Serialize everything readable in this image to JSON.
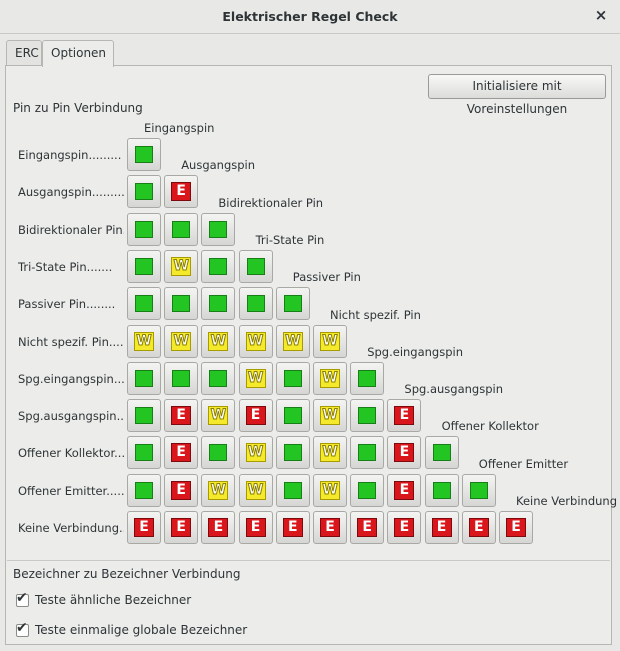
{
  "window": {
    "title": "Elektrischer Regel Check",
    "close_icon": "×"
  },
  "tabs": [
    {
      "label": "ERC",
      "active": false
    },
    {
      "label": "Optionen",
      "active": true
    }
  ],
  "init_button": "Initialisiere mit Voreinstellungen",
  "pin_section_title": "Pin zu Pin Verbindung",
  "row_labels": [
    "Eingangspin.........",
    "Ausgangspin.........",
    "Bidirektionaler Pin..",
    "Tri-State Pin.......",
    "Passiver Pin........",
    "Nicht spezif. Pin....",
    "Spg.eingangspin......",
    "Spg.ausgangspin......",
    "Offener Kollektor....",
    "Offener Emitter......",
    "Keine Verbindung....."
  ],
  "column_labels": [
    "Eingangspin",
    "Ausgangspin",
    "Bidirektionaler Pin",
    "Tri-State Pin",
    "Passiver Pin",
    "Nicht spezif. Pin",
    "Spg.eingangspin",
    "Spg.ausgangspin",
    "Offener Kollektor",
    "Offener Emitter",
    "Keine Verbindung"
  ],
  "matrix": [
    [
      "ok"
    ],
    [
      "ok",
      "E"
    ],
    [
      "ok",
      "ok",
      "ok"
    ],
    [
      "ok",
      "W",
      "ok",
      "ok"
    ],
    [
      "ok",
      "ok",
      "ok",
      "ok",
      "ok"
    ],
    [
      "W",
      "W",
      "W",
      "W",
      "W",
      "W"
    ],
    [
      "ok",
      "ok",
      "ok",
      "W",
      "ok",
      "W",
      "ok"
    ],
    [
      "ok",
      "E",
      "W",
      "E",
      "ok",
      "W",
      "ok",
      "E"
    ],
    [
      "ok",
      "E",
      "ok",
      "W",
      "ok",
      "W",
      "ok",
      "E",
      "ok"
    ],
    [
      "ok",
      "E",
      "W",
      "W",
      "ok",
      "W",
      "ok",
      "E",
      "ok",
      "ok"
    ],
    [
      "E",
      "E",
      "E",
      "E",
      "E",
      "E",
      "E",
      "E",
      "E",
      "E",
      "E"
    ]
  ],
  "status_colors": {
    "ok": "#22c522",
    "warning": "#f4ea2b",
    "error": "#d9161b"
  },
  "label_section_title": "Bezeichner zu Bezeichner Verbindung",
  "checkboxes": [
    {
      "label": "Teste ähnliche Bezeichner",
      "checked": true
    },
    {
      "label": "Teste einmalige globale Bezeichner",
      "checked": true
    }
  ]
}
